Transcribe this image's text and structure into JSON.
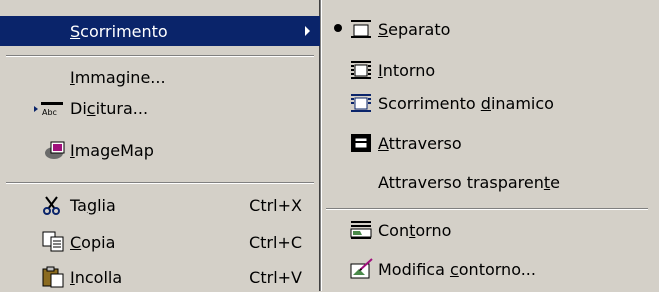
{
  "left_menu": {
    "items": [
      {
        "label": "Scorrimento",
        "accel_index": 0,
        "submenu": true
      },
      {
        "label": "Immagine...",
        "accel_index": 0
      },
      {
        "label": "Dicitura...",
        "accel_index": 2
      },
      {
        "label": "ImageMap",
        "accel_index": 0
      },
      {
        "label": "Taglia",
        "accel_index": 2,
        "shortcut": "Ctrl+X"
      },
      {
        "label": "Copia",
        "accel_index": 0,
        "shortcut": "Ctrl+C"
      },
      {
        "label": "Incolla",
        "accel_index": 0,
        "shortcut": "Ctrl+V"
      }
    ]
  },
  "right_menu": {
    "items": [
      {
        "label": "Separato",
        "accel_index": 0,
        "checked": true
      },
      {
        "label": "Intorno",
        "accel_index": 0
      },
      {
        "label": "Scorrimento dinamico",
        "accel_index": 12
      },
      {
        "label": "Attraverso",
        "accel_index": 0
      },
      {
        "label": "Attraverso trasparente",
        "accel_index": 20
      },
      {
        "label": "Contorno",
        "accel_index": 3
      },
      {
        "label": "Modifica contorno...",
        "accel_index": 9
      }
    ]
  },
  "colors": {
    "highlight": "#0a246a",
    "menu_bg": "#d4d0c8"
  }
}
